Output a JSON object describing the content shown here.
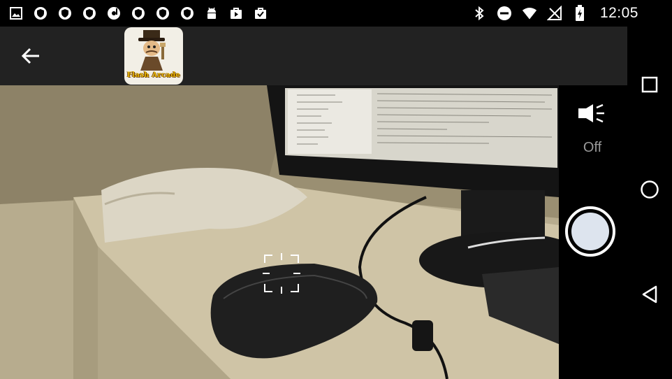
{
  "status_bar": {
    "time": "12:05",
    "notification_icons": [
      "gallery-icon",
      "vpn-shield-icon",
      "vpn-shield-icon",
      "vpn-shield-icon",
      "music-disc-icon",
      "vpn-shield-icon",
      "vpn-shield-icon",
      "vpn-shield-icon",
      "android-icon",
      "play-store-icon",
      "download-check-icon"
    ],
    "system_icons": [
      "bluetooth-icon",
      "do-not-disturb-icon",
      "wifi-icon",
      "no-signal-icon",
      "battery-charging-icon"
    ]
  },
  "toolbar": {
    "back_icon": "arrow-left-icon",
    "logo_text": "Flash Arcade",
    "colors": {
      "background": "#222222",
      "logo_text": "#e8b800"
    }
  },
  "camera": {
    "flash_icon": "flashlight-icon",
    "flash_state": "Off",
    "shutter_icon": "shutter-circle-icon",
    "focus_icon": "focus-frame-icon"
  },
  "navigation": {
    "buttons": [
      {
        "name": "recents",
        "icon": "square-icon"
      },
      {
        "name": "home",
        "icon": "circle-icon"
      },
      {
        "name": "back",
        "icon": "triangle-back-icon"
      }
    ]
  }
}
